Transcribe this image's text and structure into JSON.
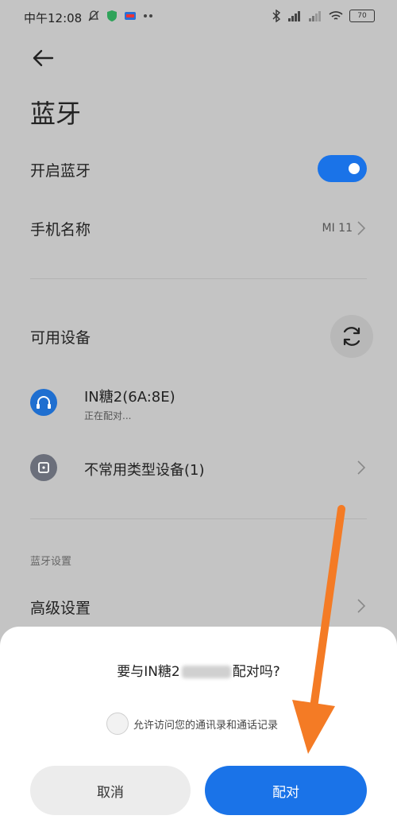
{
  "status_bar": {
    "time": "中午12:08",
    "battery": "70",
    "icons": [
      "bell-off-icon",
      "shield-icon",
      "app-icon",
      "more-dots-icon",
      "bluetooth-icon",
      "signal-icon",
      "signal-icon",
      "wifi-icon",
      "battery-icon"
    ]
  },
  "header": {
    "back_icon": "arrow-left-icon",
    "title": "蓝牙"
  },
  "settings": {
    "bluetooth_toggle": {
      "label": "开启蓝牙",
      "state": "on",
      "color": "#1a73e8"
    },
    "phone_name": {
      "label": "手机名称",
      "value": "MI 11"
    }
  },
  "available": {
    "label": "可用设备",
    "refresh_icon": "refresh-icon",
    "devices": [
      {
        "name": "IN糖2(6A:8E)",
        "status": "正在配对...",
        "icon": "headphones-icon"
      },
      {
        "name": "不常用类型设备(1)",
        "status": "",
        "icon": "device-icon"
      }
    ]
  },
  "bt_settings": {
    "section": "蓝牙设置",
    "advanced": "高级设置"
  },
  "dialog": {
    "title_prefix": "要与IN糖2",
    "title_suffix": "配对吗?",
    "checkbox_label": "允许访问您的通讯录和通话记录",
    "cancel": "取消",
    "pair": "配对"
  },
  "colors": {
    "accent": "#1a73e8",
    "annotation_arrow": "#f47b25"
  }
}
